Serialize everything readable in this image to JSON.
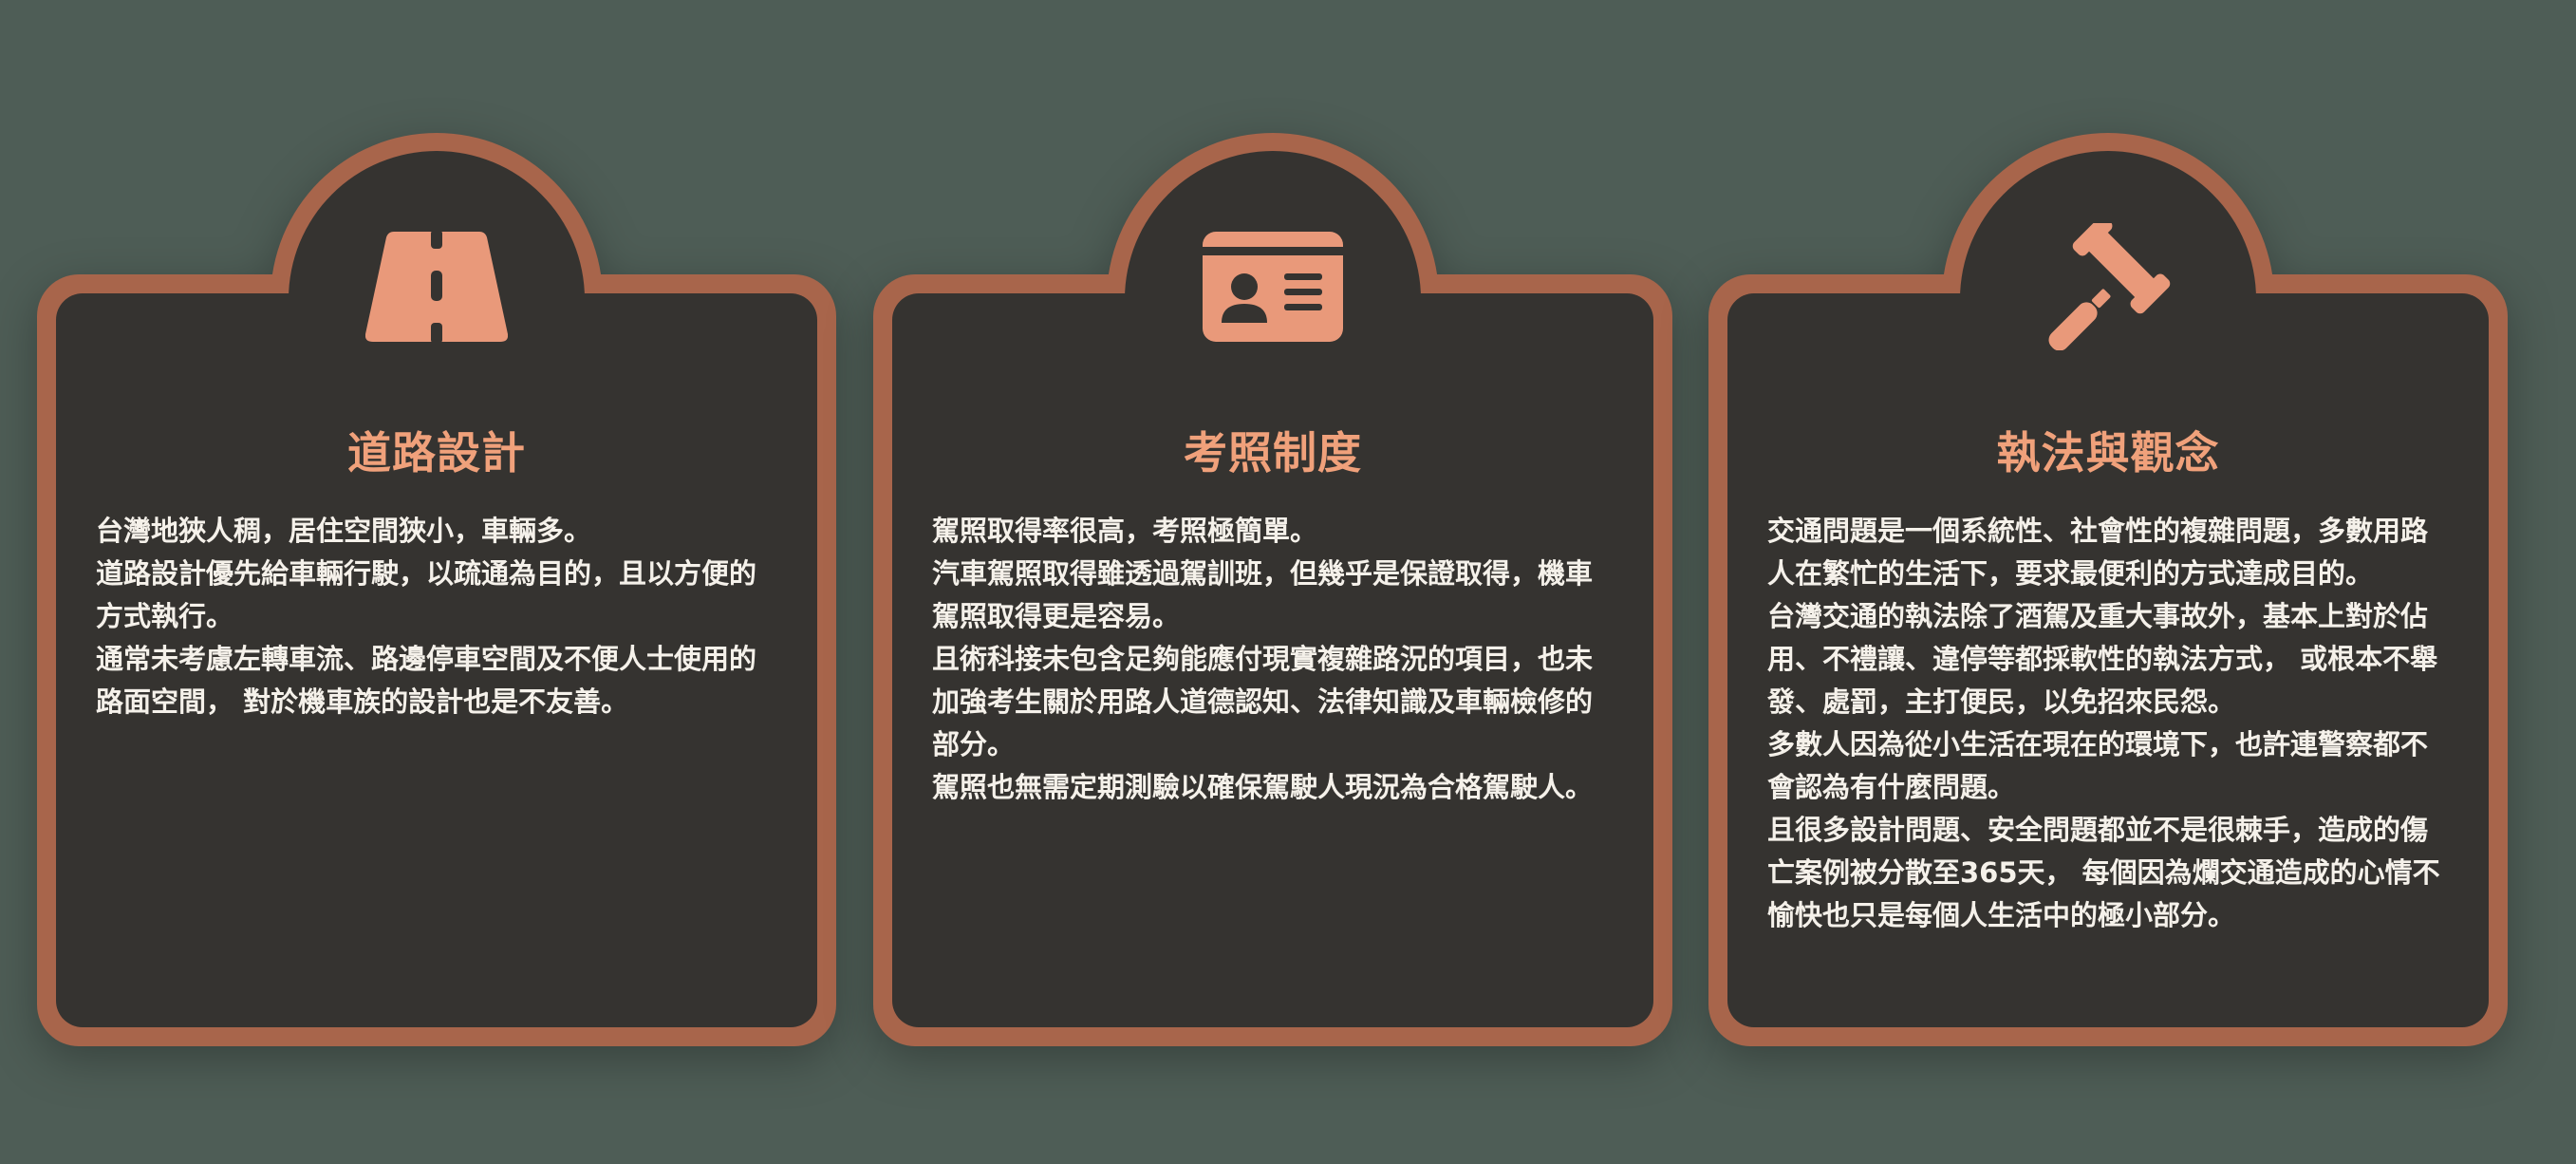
{
  "colors": {
    "background": "#4e5d56",
    "card_border": "#a8654b",
    "card_fill": "#353330",
    "accent": "#f0a17b",
    "text": "#f5f1ea"
  },
  "cards": [
    {
      "icon": "road-icon",
      "title": "道路設計",
      "paragraphs": [
        "台灣地狹人稠，居住空間狹小，車輛多。",
        "道路設計優先給車輛行駛，以疏通為目的，且以方便的方式執行。",
        "通常未考慮左轉車流、路邊停車空間及不便人士使用的路面空間， 對於機車族的設計也是不友善。"
      ]
    },
    {
      "icon": "id-card-icon",
      "title": "考照制度",
      "paragraphs": [
        "駕照取得率很高，考照極簡單。",
        "汽車駕照取得雖透過駕訓班，但幾乎是保證取得，機車駕照取得更是容易。",
        "且術科接未包含足夠能應付現實複雜路況的項目，也未加強考生關於用路人道德認知、法律知識及車輛檢修的部分。",
        "駕照也無需定期測驗以確保駕駛人現況為合格駕駛人。"
      ]
    },
    {
      "icon": "gavel-icon",
      "title": "執法與觀念",
      "paragraphs": [
        "交通問題是一個系統性、社會性的複雜問題，多數用路人在繁忙的生活下，要求最便利的方式達成目的。",
        "台灣交通的執法除了酒駕及重大事故外，基本上對於佔用、不禮讓、違停等都採軟性的執法方式， 或根本不舉發、處罰，主打便民，以免招來民怨。",
        "多數人因為從小生活在現在的環境下，也許連警察都不會認為有什麼問題。",
        "且很多設計問題、安全問題都並不是很棘手，造成的傷亡案例被分散至365天， 每個因為爛交通造成的心情不愉快也只是每個人生活中的極小部分。"
      ]
    }
  ]
}
